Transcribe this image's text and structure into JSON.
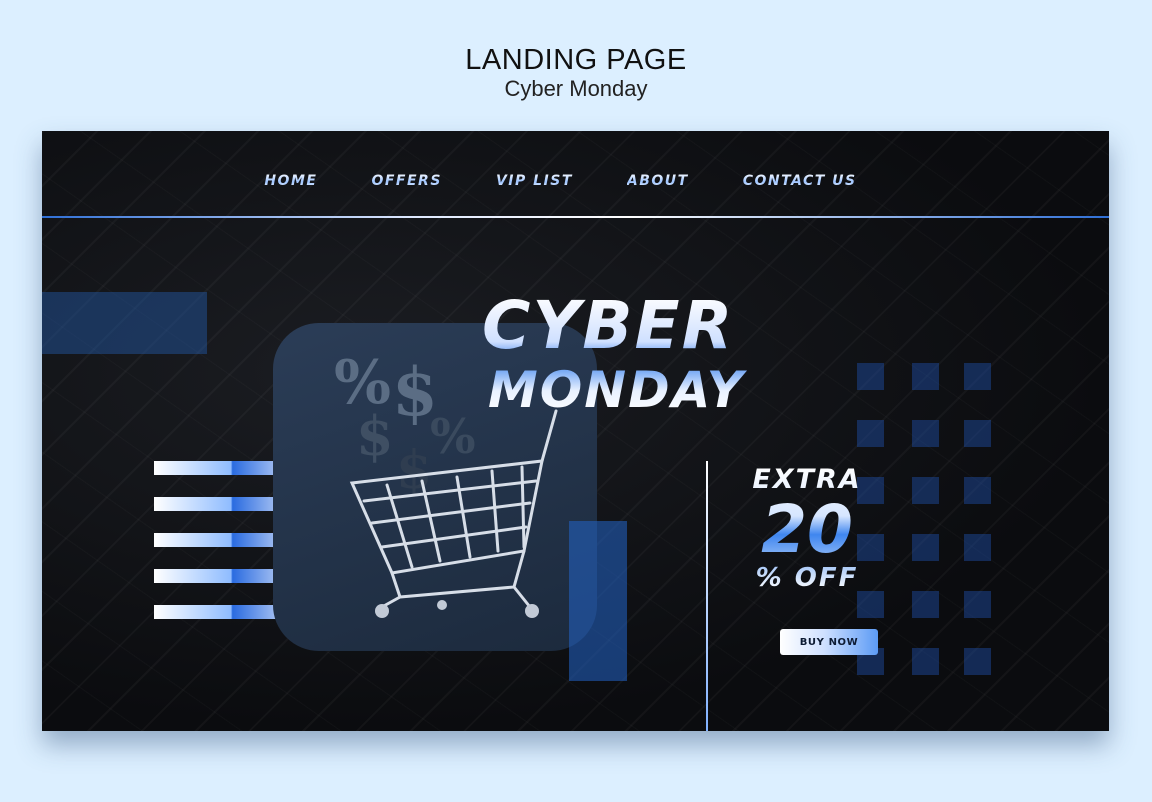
{
  "caption": {
    "title": "LANDING PAGE",
    "subtitle": "Cyber Monday"
  },
  "nav": {
    "items": [
      "HOME",
      "OFFERS",
      "VIP LIST",
      "ABOUT",
      "CONTACT US"
    ]
  },
  "hero": {
    "headline_1": "CYBER",
    "headline_2": "MONDAY",
    "offer_line_1": "EXTRA",
    "offer_line_2": "20",
    "offer_line_3": "% OFF",
    "cta": "BUY NOW",
    "card_glyphs": [
      "%",
      "$",
      "$",
      "%",
      "$"
    ]
  },
  "colors": {
    "background": "#0c0d10",
    "accent": "#2f6fd6",
    "page": "#dcefff"
  }
}
